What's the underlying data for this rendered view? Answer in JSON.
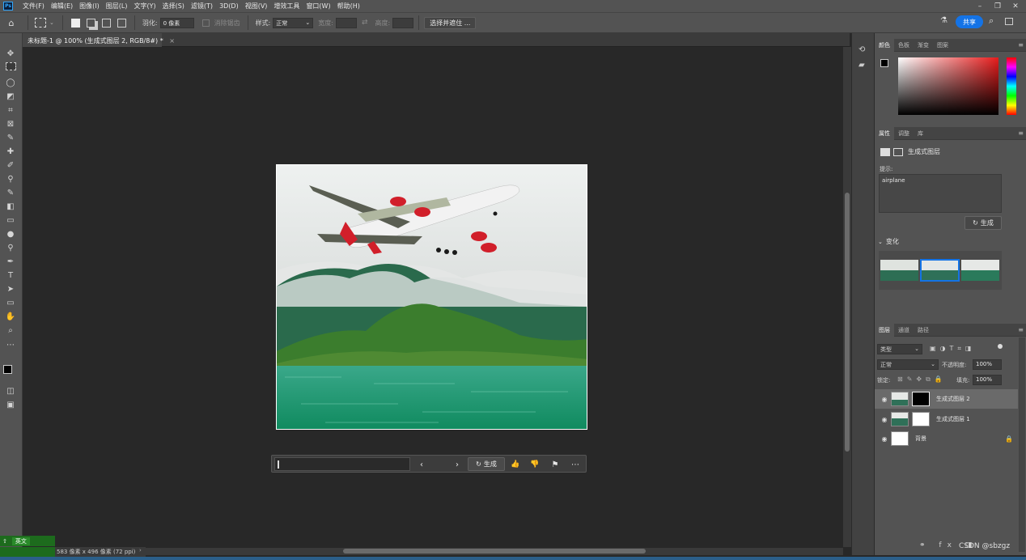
{
  "menu": {
    "app_logo": "Ps",
    "items": [
      "文件(F)",
      "编辑(E)",
      "图像(I)",
      "图层(L)",
      "文字(Y)",
      "选择(S)",
      "滤镜(T)",
      "3D(D)",
      "视图(V)",
      "增效工具",
      "窗口(W)",
      "帮助(H)"
    ]
  },
  "options": {
    "feather_label": "羽化:",
    "feather_value": "0 像素",
    "antialias_label": "消除锯齿",
    "style_label": "样式:",
    "style_value": "正常",
    "width_label": "宽度:",
    "height_label": "高度:",
    "select_mask_button": "选择并遮住 ...",
    "share_button": "共享"
  },
  "document": {
    "tab_title": "未标题-1 @ 100% (生成式图层 2, RGB/8#) *",
    "close_glyph": "×"
  },
  "status": {
    "doc_size": "583 像素 x 496 像素 (72 ppi)",
    "ime_label": "英文"
  },
  "context_bar": {
    "generate_label": "生成"
  },
  "color_panel": {
    "tabs": [
      "颜色",
      "色板",
      "渐变",
      "图案"
    ],
    "accent_red": "#e81c1c"
  },
  "properties_panel": {
    "tabs": [
      "属性",
      "调整",
      "库"
    ],
    "layer_type": "生成式图层",
    "prompt_label": "提示:",
    "prompt_value": "airplane",
    "generate_button": "生成",
    "variations_label": "变化"
  },
  "layers_panel": {
    "tabs": [
      "图层",
      "通道",
      "路径"
    ],
    "filter_type": "类型",
    "blend_mode": "正常",
    "opacity_label": "不透明度:",
    "opacity_value": "100%",
    "lock_label": "锁定:",
    "fill_label": "填充:",
    "fill_value": "100%",
    "layers": [
      {
        "name": "生成式图层 2",
        "selected": true
      },
      {
        "name": "生成式图层 1",
        "selected": false
      },
      {
        "name": "背景",
        "selected": false
      }
    ]
  },
  "watermark": "CSDN @sbzgz",
  "colors": {
    "accent_blue": "#1473e6",
    "panel_bg": "#535353",
    "canvas_bg": "#282828"
  }
}
